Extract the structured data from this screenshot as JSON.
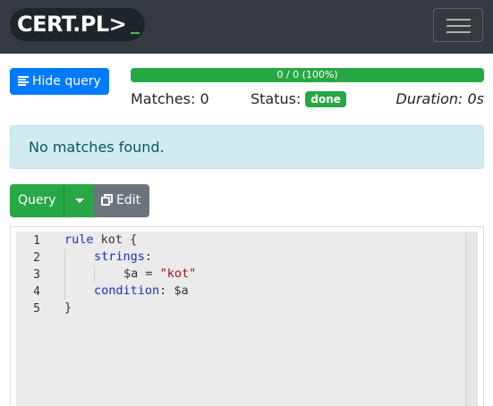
{
  "navbar": {
    "logo_text": "CERT.PL>",
    "toggler_icon": "hamburger-icon"
  },
  "toolbar": {
    "hide_query_label": "Hide query",
    "hide_icon": "align-left-icon"
  },
  "progress": {
    "label": "0 / 0 (100%)",
    "percent": 100
  },
  "stats": {
    "matches_label": "Matches: 0",
    "status_label": "Status:",
    "status_value": "done",
    "duration_label": "Duration: 0s"
  },
  "alert": {
    "message": "No matches found."
  },
  "actions": {
    "query_label": "Query",
    "edit_label": "Edit",
    "edit_icon": "copy-icon",
    "caret_icon": "caret-down-icon"
  },
  "editor": {
    "line_numbers": [
      "1",
      "2",
      "3",
      "4",
      "5"
    ],
    "lines": [
      {
        "keyword": "rule",
        "rest": " kot {"
      },
      {
        "keyword": "strings",
        "rest": ":"
      },
      {
        "variable": "$a = ",
        "string": "\"kot\""
      },
      {
        "keyword": "condition",
        "rest": ": $a"
      },
      {
        "rest": "}"
      }
    ]
  },
  "colors": {
    "primary": "#007bff",
    "success": "#28a745",
    "secondary": "#6c757d",
    "info_bg": "#d1ecf1",
    "navbar": "#343a40"
  }
}
